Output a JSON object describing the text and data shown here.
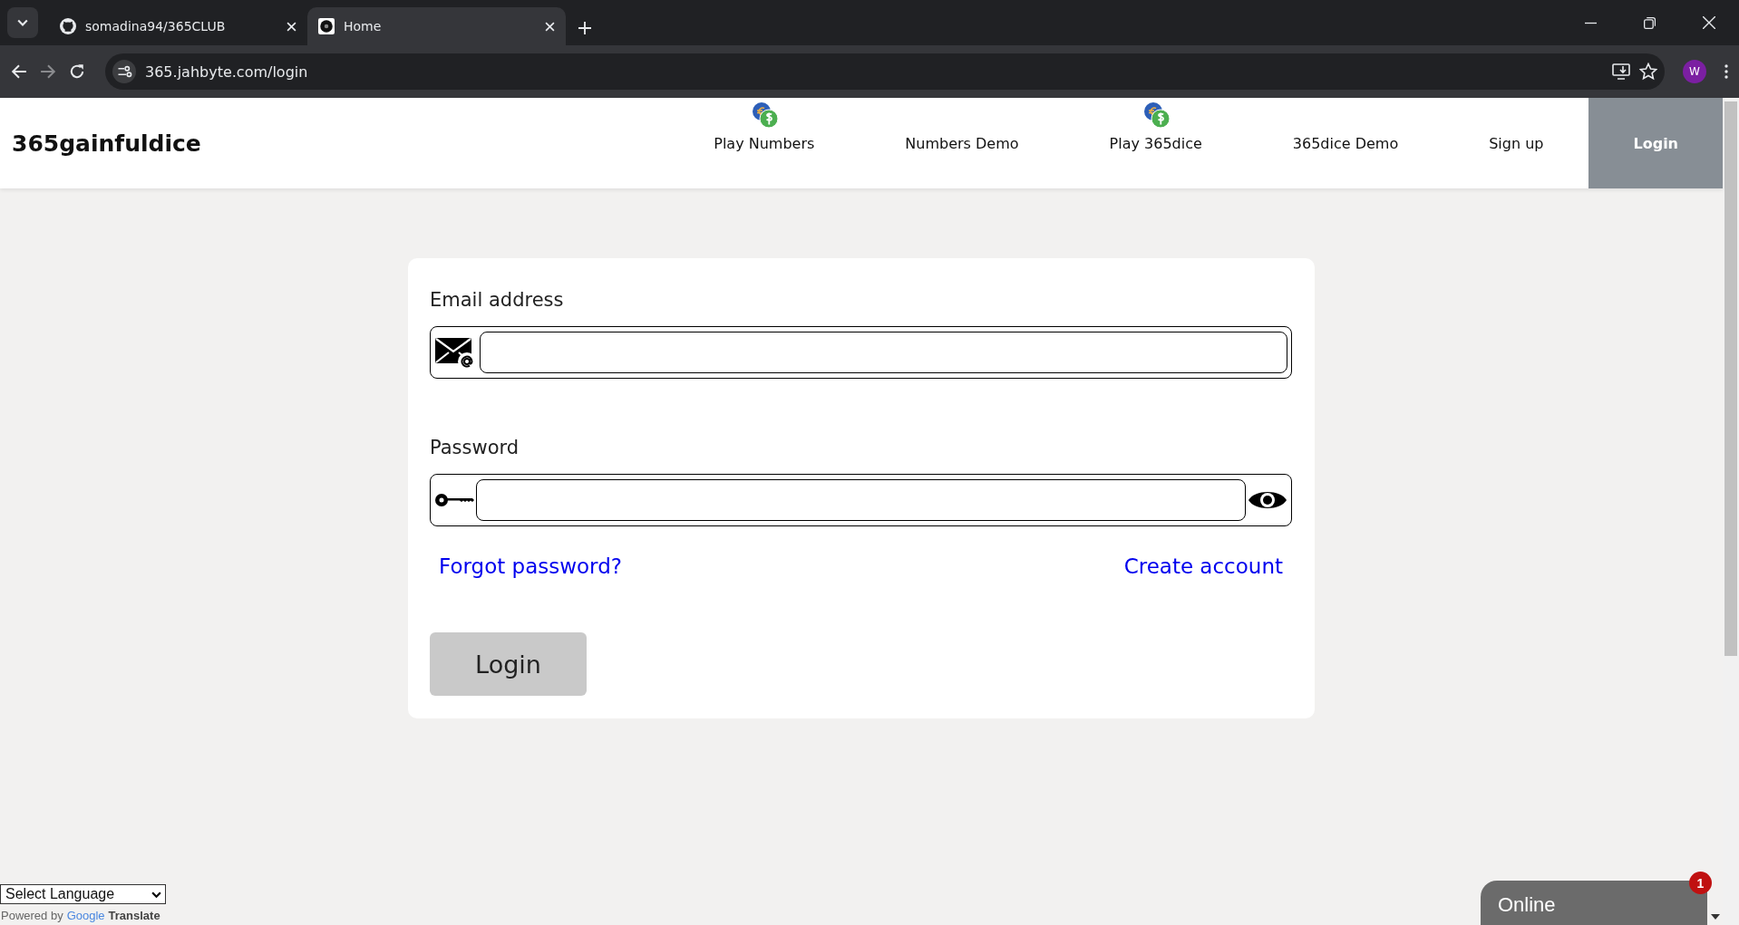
{
  "browser": {
    "tabs": [
      {
        "title": "somadina94/365CLUB",
        "selected": false,
        "kind": "github"
      },
      {
        "title": "Home",
        "selected": true,
        "kind": "site"
      }
    ],
    "url": "365.jahbyte.com/login",
    "profile_initial": "W"
  },
  "header": {
    "brand": "365gainfuldice",
    "nav": [
      {
        "label": "Play Numbers",
        "kind": "coins",
        "selected": false
      },
      {
        "label": "Numbers Demo",
        "kind": "plain",
        "selected": false
      },
      {
        "label": "Play 365dice",
        "kind": "coins",
        "selected": false
      },
      {
        "label": "365dice Demo",
        "kind": "plain",
        "selected": false
      },
      {
        "label": "Sign up",
        "kind": "plain",
        "selected": false
      },
      {
        "label": "Login",
        "kind": "plain",
        "selected": true
      }
    ]
  },
  "login_form": {
    "email_label": "Email address",
    "password_label": "Password",
    "forgot_link": "Forgot password?",
    "create_link": "Create account",
    "submit": "Login"
  },
  "translate": {
    "select": "Select Language",
    "powered_by": "Powered by",
    "google": "Google",
    "translate": "Translate"
  },
  "chat": {
    "status": "Online",
    "badge": "1"
  }
}
